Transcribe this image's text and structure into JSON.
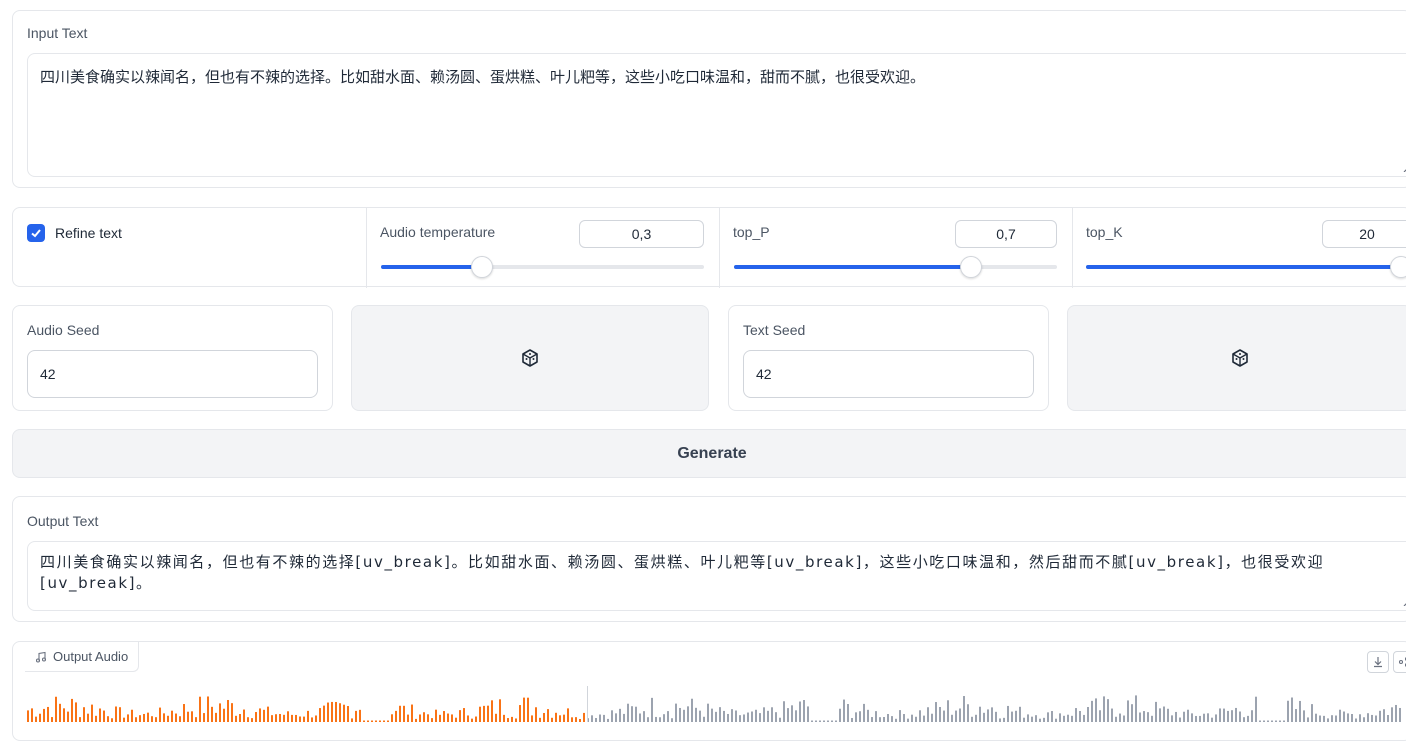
{
  "input_text": {
    "label": "Input Text",
    "value": "四川美食确实以辣闻名，但也有不辣的选择。比如甜水面、赖汤圆、蛋烘糕、叶儿粑等，这些小吃口味温和，甜而不腻，也很受欢迎。"
  },
  "params": {
    "refine_text": {
      "label": "Refine text",
      "checked": true
    },
    "audio_temperature": {
      "label": "Audio temperature",
      "value": "0,3",
      "fraction": 0.3
    },
    "top_p": {
      "label": "top_P",
      "value": "0,7",
      "fraction": 0.7
    },
    "top_k": {
      "label": "top_K",
      "value": "20",
      "fraction": 1.0
    }
  },
  "seeds": {
    "audio_seed": {
      "label": "Audio Seed",
      "value": "42"
    },
    "text_seed": {
      "label": "Text Seed",
      "value": "42"
    },
    "dice_icon": "dice-icon"
  },
  "generate": {
    "label": "Generate"
  },
  "output_text": {
    "label": "Output Text",
    "value": "四川美食确实以辣闻名，但也有不辣的选择[uv_break]。比如甜水面、赖汤圆、蛋烘糕、叶儿粑等[uv_break]，这些小吃口味温和，然后甜而不腻[uv_break]，也很受欢迎[uv_break]。"
  },
  "output_audio": {
    "label": "Output Audio",
    "icon": "music-note-icon",
    "played_fraction": 0.41,
    "played_color": "#f97316",
    "unplayed_color": "#9ca3af"
  },
  "colors": {
    "accent": "#2563eb",
    "checkbox": "#2563eb"
  }
}
